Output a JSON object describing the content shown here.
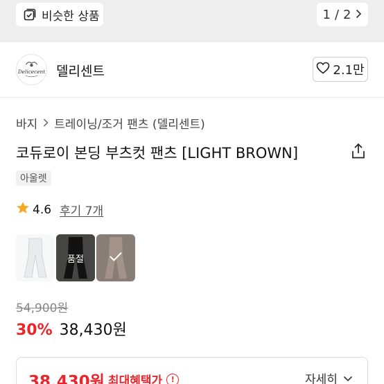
{
  "top": {
    "similar_label": "비슷한 상품",
    "pager": {
      "current": "1",
      "separator": "/",
      "total": "2"
    }
  },
  "brand": {
    "logo_text": "Delicecent",
    "name": "델리센트",
    "likes": "2.1만"
  },
  "breadcrumb": [
    "바지",
    "트레이닝/조거 팬츠 (델리센트)"
  ],
  "product": {
    "title": "코듀로이 본딩 부츠컷 팬츠 [LIGHT BROWN]",
    "tag": "아울렛",
    "rating": "4.6",
    "reviews": "후기 7개",
    "thumbnails": [
      {
        "color": "light gray",
        "state": ""
      },
      {
        "color": "black",
        "state": "품절"
      },
      {
        "color": "light brown",
        "state": "selected"
      }
    ]
  },
  "price": {
    "original": "54,900원",
    "discount": "30%",
    "sale": "38,430원"
  },
  "benefit": {
    "price": "38,430원",
    "label": "최대혜택가",
    "info_icon": "!",
    "detail": "자세히"
  },
  "colors": {
    "accent_red": "#e8262b",
    "star": "#f5a623"
  }
}
